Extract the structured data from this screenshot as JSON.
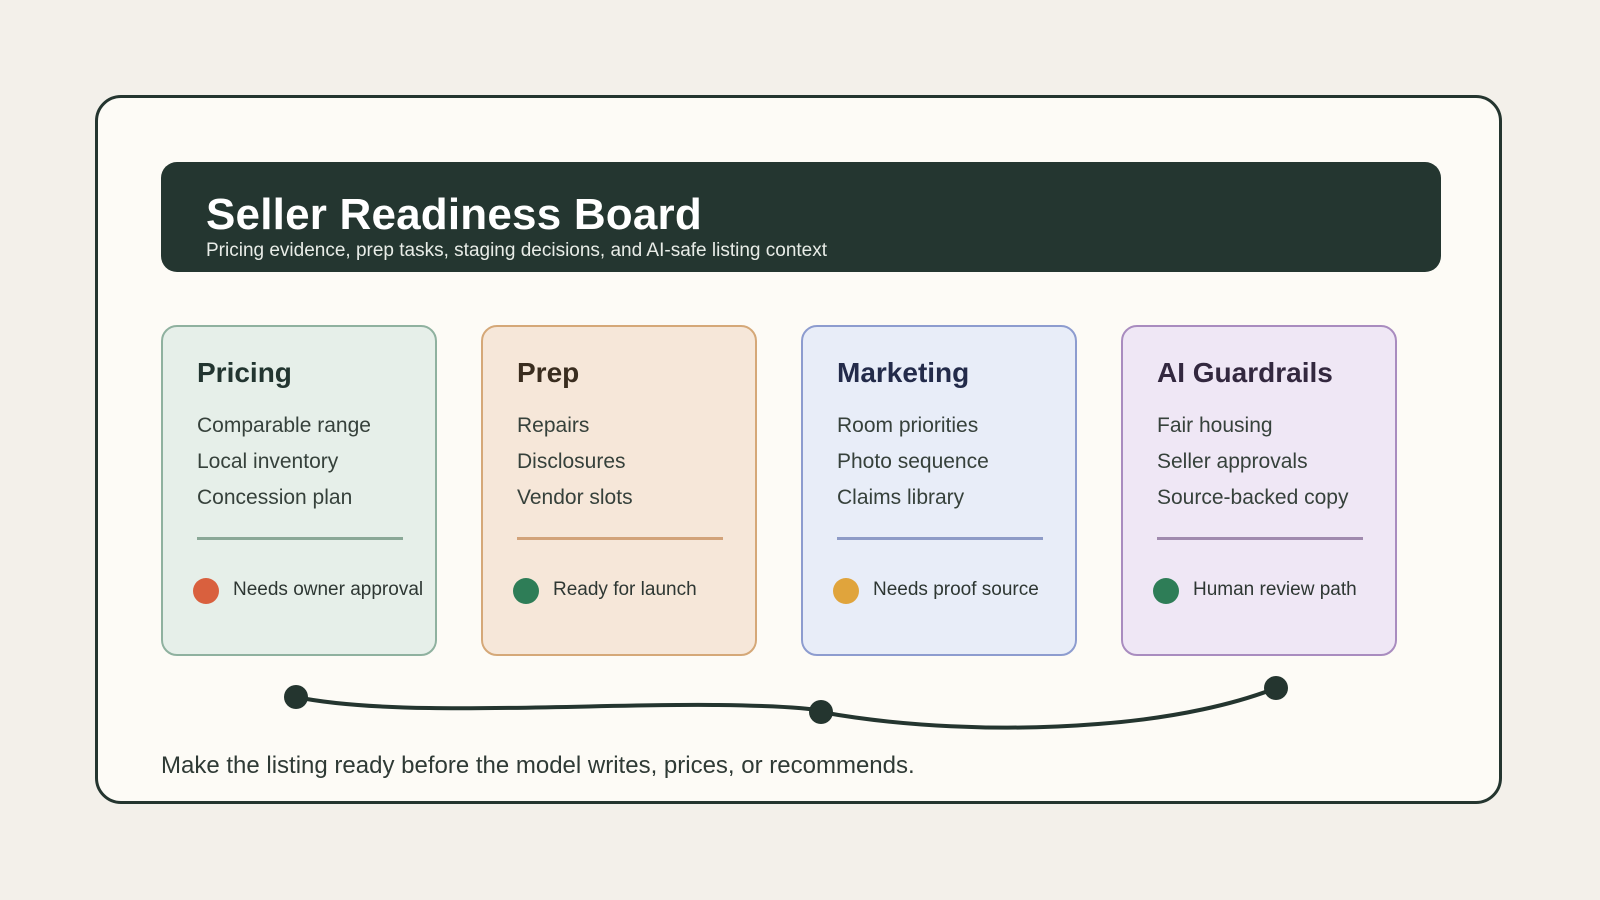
{
  "header": {
    "title": "Seller Readiness Board",
    "subtitle": "Pricing evidence, prep tasks, staging decisions, and AI-safe listing context"
  },
  "cards": [
    {
      "title": "Pricing",
      "items": [
        "Comparable range",
        "Local inventory",
        "Concession plan"
      ],
      "status": {
        "label": "Needs owner approval",
        "color": "#d9603e"
      }
    },
    {
      "title": "Prep",
      "items": [
        "Repairs",
        "Disclosures",
        "Vendor slots"
      ],
      "status": {
        "label": "Ready for launch",
        "color": "#2e7d57"
      }
    },
    {
      "title": "Marketing",
      "items": [
        "Room priorities",
        "Photo sequence",
        "Claims library"
      ],
      "status": {
        "label": "Needs proof source",
        "color": "#e0a43c"
      }
    },
    {
      "title": "AI Guardrails",
      "items": [
        "Fair housing",
        "Seller approvals",
        "Source-backed copy"
      ],
      "status": {
        "label": "Human review path",
        "color": "#2e7d57"
      }
    }
  ],
  "footer": {
    "note": "Make the listing ready before the model writes, prices, or recommends."
  },
  "colors": {
    "background": "#f3f0ea",
    "board": "#fdfbf6",
    "header": "#243630",
    "connector": "#24352f"
  }
}
